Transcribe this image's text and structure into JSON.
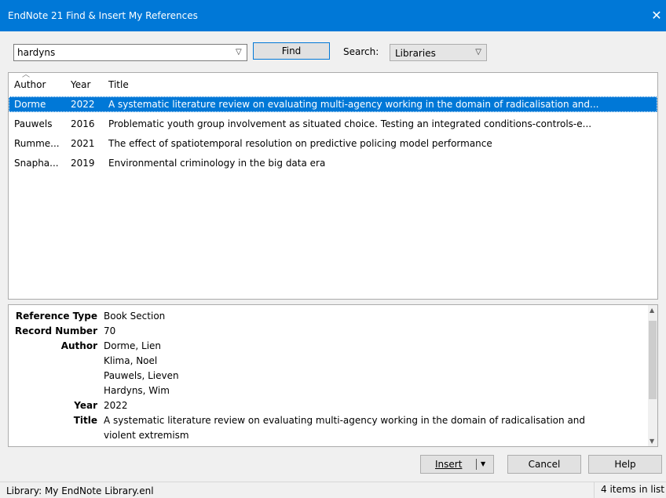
{
  "window": {
    "title": "EndNote 21 Find & Insert My References",
    "close_glyph": "✕"
  },
  "toolbar": {
    "query_value": "hardyns",
    "find_label": "Find",
    "search_label": "Search:",
    "search_scope": "Libraries"
  },
  "list": {
    "columns": {
      "author": "Author",
      "year": "Year",
      "title": "Title"
    },
    "rows": [
      {
        "author": "Dorme",
        "year": "2022",
        "title": "A systematic literature review on evaluating multi-agency working in the domain of radicalisation and..."
      },
      {
        "author": "Pauwels",
        "year": "2016",
        "title": "Problematic youth group involvement as situated choice. Testing an integrated conditions-controls-e..."
      },
      {
        "author": "Rumme...",
        "year": "2021",
        "title": "The effect of spatiotemporal resolution on predictive policing model performance"
      },
      {
        "author": "Snapha...",
        "year": "2019",
        "title": "Environmental criminology in the big data era"
      }
    ]
  },
  "detail": {
    "reference_type_label": "Reference Type",
    "reference_type": "Book Section",
    "record_number_label": "Record Number",
    "record_number": "70",
    "author_label": "Author",
    "authors": [
      "Dorme, Lien",
      "Klima, Noel",
      "Pauwels, Lieven",
      "Hardyns, Wim"
    ],
    "year_label": "Year",
    "year": "2022",
    "title_label": "Title",
    "title_line1": "A systematic literature review on evaluating multi-agency working in the domain of radicalisation and",
    "title_line2": "violent extremism"
  },
  "buttons": {
    "insert": "Insert",
    "cancel": "Cancel",
    "help": "Help"
  },
  "status": {
    "library": "Library: My EndNote Library.enl",
    "count": "4 items in list"
  },
  "colors": {
    "titlebar": "#0078d7",
    "selection": "#0078d7"
  }
}
